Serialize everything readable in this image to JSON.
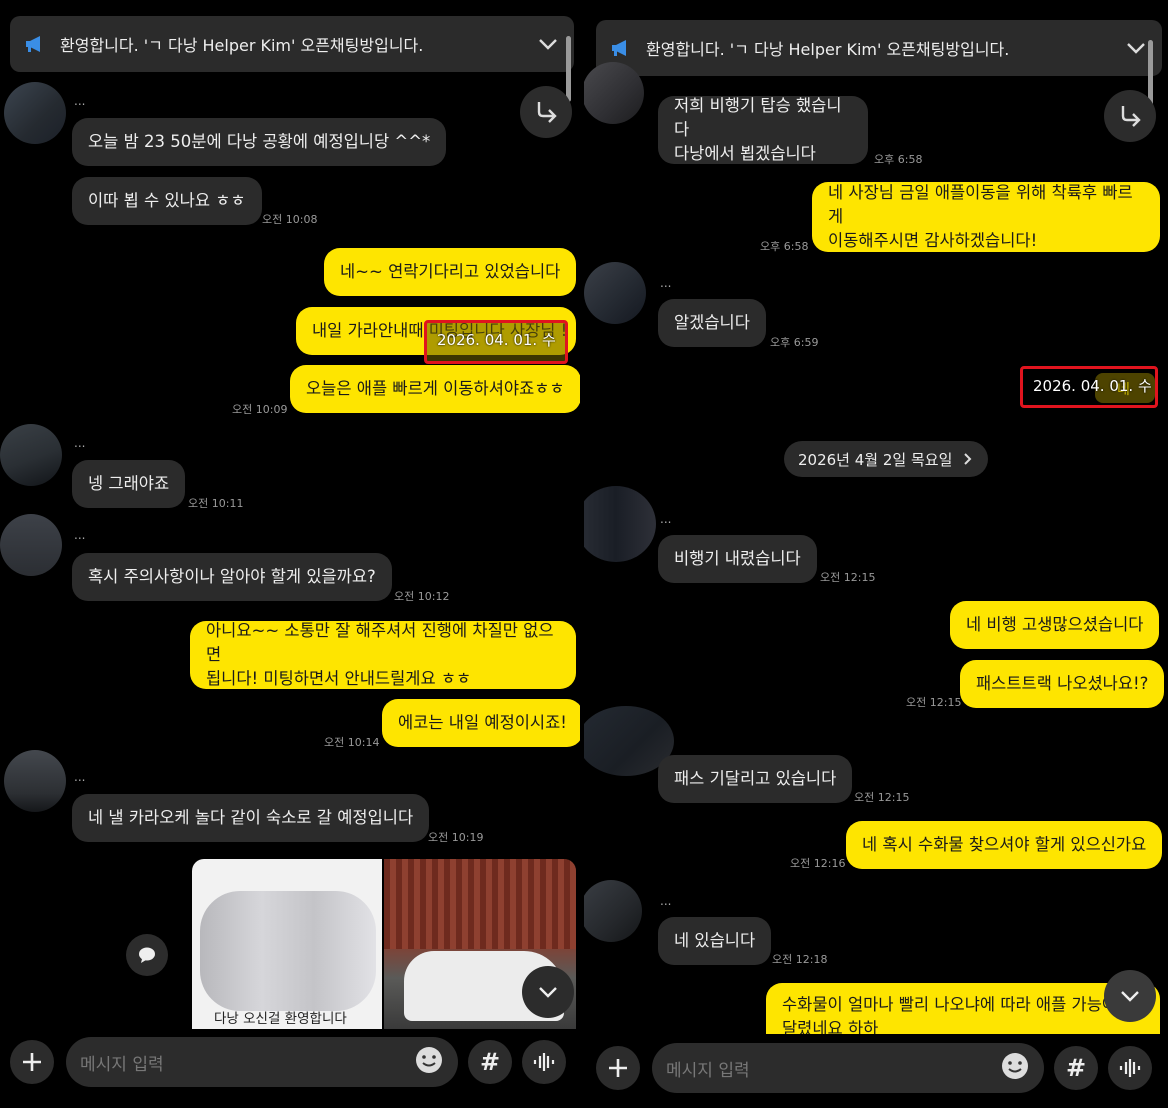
{
  "colors": {
    "background": "#000000",
    "incoming": "#2b2b2b",
    "outgoing": "#fee500",
    "highlight": "#e0141e",
    "accent": "#3a8ee6"
  },
  "left": {
    "notice": {
      "icon": "megaphone-icon",
      "text": "환영합니다. 'ㄱ 다낭 Helper Kim' 오픈채팅방입니다."
    },
    "messages": [
      {
        "nick": "...",
        "text": "오늘 밤 23 50분에 다낭 공황에 예정입니당 ^^*"
      },
      {
        "text": "이따 뵙 수 있나요 ㅎㅎ",
        "time": "오전 10:08"
      },
      {
        "text": "네~~  연락기다리고 있었습니다"
      },
      {
        "text": "내일 가라안내때 미팅입니다 사장님 !"
      },
      {
        "text": "오늘은 애플 빠르게 이동하셔야죠ㅎㅎ",
        "time": "오전 10:09"
      },
      {
        "nick": "...",
        "text": "넹 그래야죠",
        "time": "오전 10:11"
      },
      {
        "nick": "...",
        "text": "혹시 주의사항이나 알아야 할게 있을까요?",
        "time": "오전 10:12"
      },
      {
        "line1": "아니요~~ 소통만 잘 해주셔서 진행에 차질만 없으면",
        "line2": "됩니다! 미팅하면서 안내드릴게요 ㅎㅎ"
      },
      {
        "text": "에코는 내일 예정이시죠!",
        "time": "오전 10:14"
      },
      {
        "nick": "...",
        "text": "네 낼 카라오케 놀다 같이 숙소로 갈 예정입니다",
        "time": "오전 10:19"
      }
    ],
    "stamp": "2026. 04. 01. 수",
    "photo_caption": "다낭 오신걸 환영합니다",
    "input": {
      "placeholder": "메시지 입력"
    }
  },
  "right": {
    "notice": {
      "icon": "megaphone-icon",
      "text": "환영합니다. 'ㄱ 다낭 Helper Kim' 오픈채팅방입니다."
    },
    "messages": [
      {
        "line1": "저희 비행기 탑승 했습니다",
        "line2": "다낭에서 뵙겠습니다",
        "time": "오후 6:58"
      },
      {
        "line1": "네 사장님 금일 애플이동을 위해 착륙후 빠르게",
        "line2": "이동해주시면 감사하겠습니다!",
        "time": "오후 6:58"
      },
      {
        "nick": "...",
        "text": "알겠습니다",
        "time": "오후 6:59"
      },
      {
        "nick": "...",
        "text": "비행기 내렸습니다",
        "time": "오전 12:15"
      },
      {
        "text": "네 비행 고생많으셨습니다"
      },
      {
        "text": "패스트트랙 나오셨나요!?",
        "time": "오전 12:15"
      },
      {
        "text": "패스 기달리고 있습니다",
        "time": "오전 12:15"
      },
      {
        "text": "네 혹시 수화물 찾으셔야 할게 있으신가요",
        "time": "오전 12:16"
      },
      {
        "nick": "...",
        "text": "네 있습니다",
        "time": "오전 12:18"
      },
      {
        "line1": "수화물이 얼마나 빨리 나오냐에 따라 애플 가능여부",
        "line2": "달렸네요   하하"
      }
    ],
    "stamp": "2026. 04. 01. 수",
    "stamp_under": "네",
    "date_divider": "2026년 4월 2일 목요일",
    "input": {
      "placeholder": "메시지 입력"
    }
  }
}
